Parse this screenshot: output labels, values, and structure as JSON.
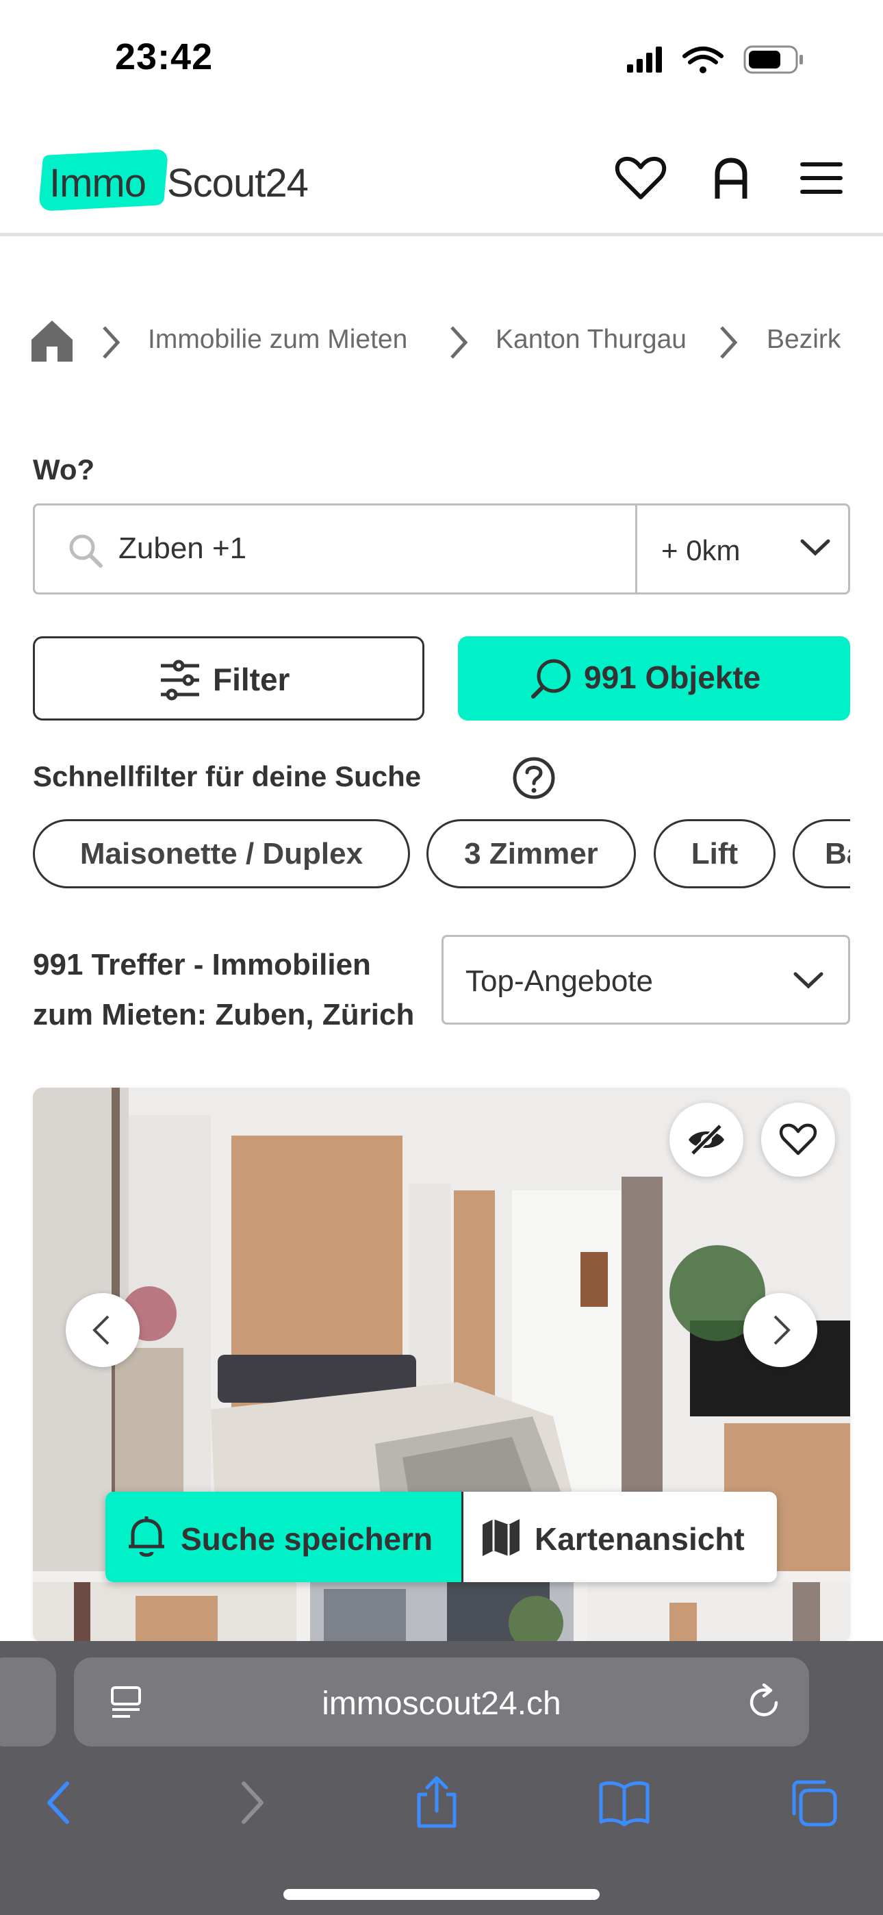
{
  "status_bar": {
    "time": "23:42",
    "icons": [
      "signal-icon",
      "wifi-icon",
      "battery-icon"
    ]
  },
  "header": {
    "logo_part1": "Immo",
    "logo_part2": "Scout24",
    "icons": [
      "heart-icon",
      "user-icon",
      "menu-icon"
    ],
    "accent_color": "#00f0c8"
  },
  "breadcrumb": {
    "items": [
      "Immobilie zum Mieten",
      "Kanton Thurgau",
      "Bezirk"
    ]
  },
  "search": {
    "label": "Wo?",
    "location_value": "Zuben +1",
    "radius_value": "+ 0km"
  },
  "actions": {
    "filter_label": "Filter",
    "results_label": "991 Objekte"
  },
  "quick_filters": {
    "title": "Schnellfilter für deine Suche",
    "chips": [
      "Maisonette / Duplex",
      "3 Zimmer",
      "Lift",
      "Ba"
    ]
  },
  "results": {
    "heading_line1": "991 Treffer - Immobilien",
    "heading_line2": "zum Mieten: Zuben, Zürich",
    "sort_value": "Top-Angebote"
  },
  "floating_bar": {
    "save_search_label": "Suche speichern",
    "map_view_label": "Kartenansicht"
  },
  "browser": {
    "url": "immoscout24.ch",
    "toolbar_icons": [
      "back-icon",
      "forward-icon",
      "share-icon",
      "bookmarks-icon",
      "tabs-icon"
    ]
  }
}
